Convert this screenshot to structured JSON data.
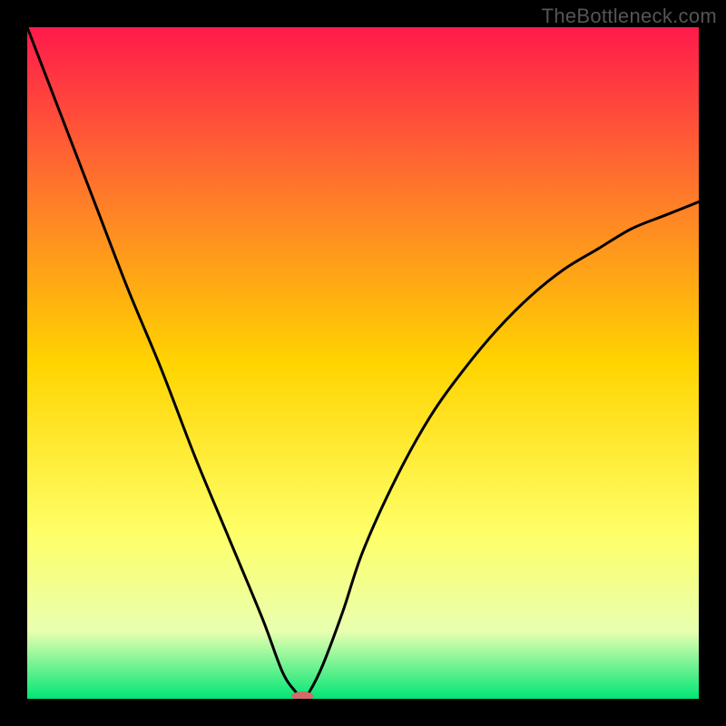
{
  "watermark": "TheBottleneck.com",
  "chart_data": {
    "type": "line",
    "title": "",
    "xlabel": "",
    "ylabel": "",
    "xlim": [
      0,
      100
    ],
    "ylim": [
      0,
      100
    ],
    "background_gradient": {
      "top": "#ff1a4b",
      "mid_upper": "#ff7a2a",
      "mid": "#ffd400",
      "mid_lower": "#ffff66",
      "lower": "#e8ffb0",
      "bottom": "#00e676"
    },
    "series": [
      {
        "name": "bottleneck_curve",
        "color": "#000000",
        "x": [
          0,
          5,
          10,
          15,
          20,
          25,
          30,
          35,
          38,
          40,
          41,
          42,
          44,
          47,
          50,
          55,
          60,
          65,
          70,
          75,
          80,
          85,
          90,
          95,
          100
        ],
        "values": [
          100,
          87,
          74,
          61,
          49,
          36,
          24,
          12,
          4,
          1,
          0,
          1,
          5,
          13,
          22,
          33,
          42,
          49,
          55,
          60,
          64,
          67,
          70,
          72,
          74
        ]
      }
    ],
    "marker": {
      "x": 41,
      "y": 0,
      "color": "#d46a6a",
      "rx": 12,
      "ry": 5
    }
  }
}
